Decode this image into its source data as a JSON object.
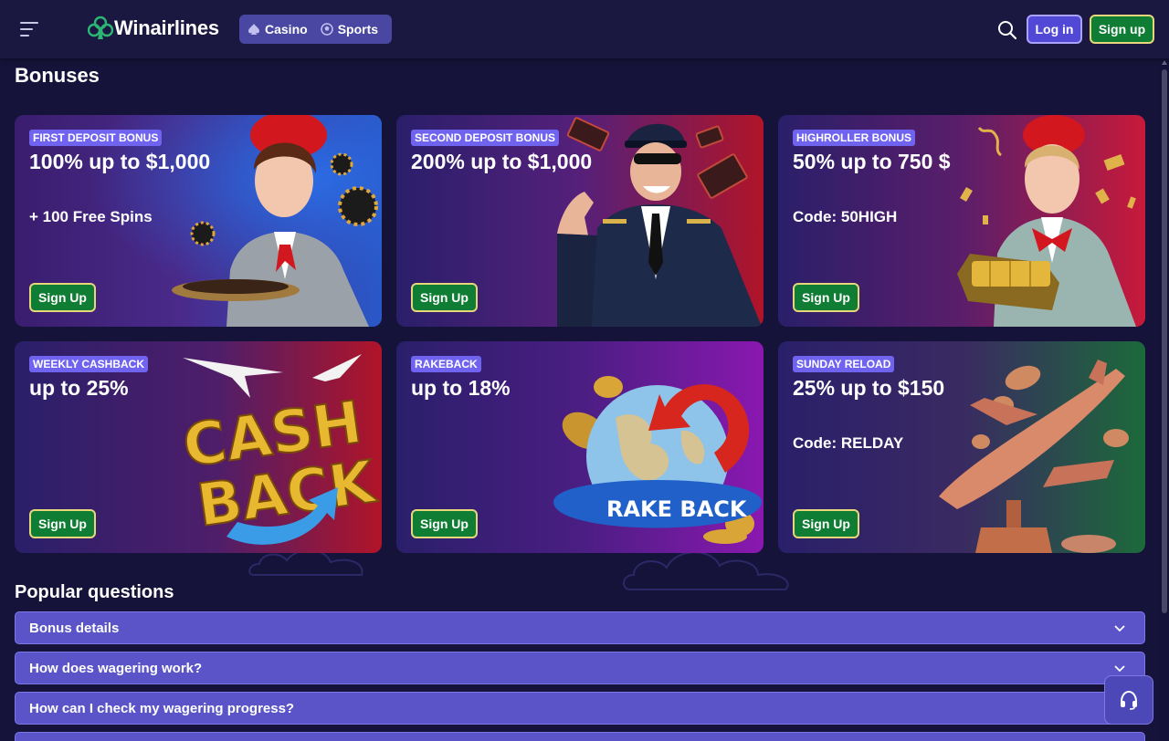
{
  "header": {
    "logo_text": "Winairlines",
    "nav": [
      {
        "label": "Casino",
        "icon": "spade-icon"
      },
      {
        "label": "Sports",
        "icon": "soccer-ball-icon"
      }
    ],
    "login_label": "Log in",
    "signup_label": "Sign up"
  },
  "page": {
    "title": "Bonuses"
  },
  "bonuses": [
    {
      "tag": "FIRST DEPOSIT BONUS",
      "headline": "100% up to $1,000",
      "subline": "+ 100 Free Spins",
      "button": "Sign Up",
      "art": "flight-attendant-with-chips"
    },
    {
      "tag": "SECOND DEPOSIT BONUS",
      "headline": "200% up to $1,000",
      "subline": "",
      "button": "Sign Up",
      "art": "pilot-with-money"
    },
    {
      "tag": "HIGHROLLER BONUS",
      "headline": "50% up to 750 $",
      "subline": "Code: 50HIGH",
      "button": "Sign Up",
      "art": "flight-attendant-with-gold"
    },
    {
      "tag": "WEEKLY CASHBACK",
      "headline": "up to 25%",
      "subline": "",
      "button": "Sign Up",
      "art": "cash-back-lettering"
    },
    {
      "tag": "RAKEBACK",
      "headline": "up to 18%",
      "subline": "",
      "button": "Sign Up",
      "art": "rake-back-globe",
      "art_text": "RAKE BACK"
    },
    {
      "tag": "SUNDAY RELOAD",
      "headline": "25% up to $150",
      "subline": "Code: RELDAY",
      "button": "Sign Up",
      "art": "jeweled-airplane-trophy"
    }
  ],
  "art_text": {
    "cash": "CASH",
    "back": "BACK",
    "rake_back": "RAKE BACK"
  },
  "faq": {
    "title": "Popular questions",
    "items": [
      {
        "label": "Bonus details"
      },
      {
        "label": "How does wagering work?"
      },
      {
        "label": "How can I check my wagering progress?"
      }
    ]
  },
  "colors": {
    "background": "#16133a",
    "accent": "#6f63f0",
    "signup_green": "#0f7d33",
    "gold_border": "#e8d77a",
    "faq_bar": "#5a54c8"
  }
}
